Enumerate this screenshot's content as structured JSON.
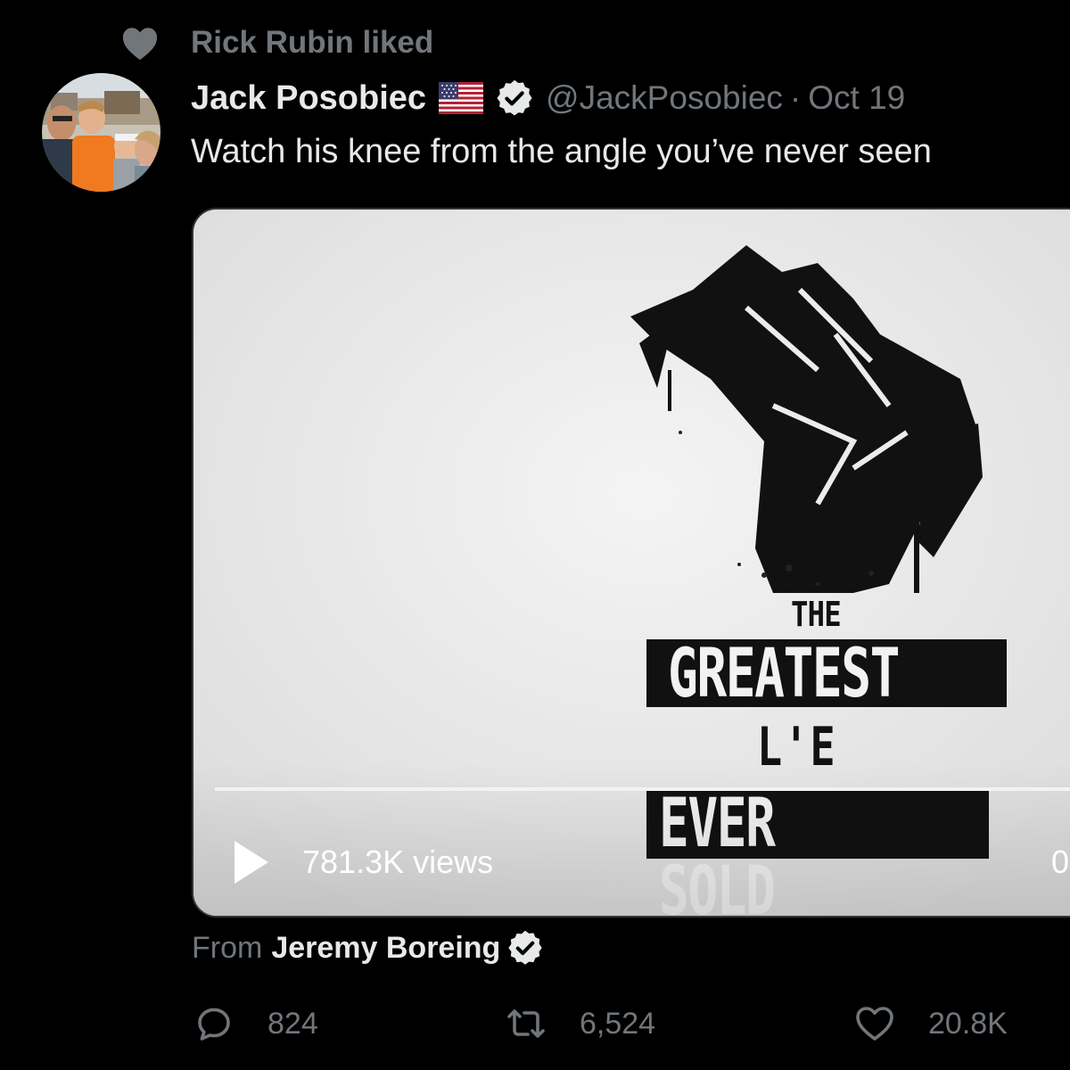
{
  "social_context": {
    "icon": "heart-icon",
    "text": "Rick Rubin liked"
  },
  "tweet": {
    "author_name": "Jack Posobiec",
    "flag_icon": "us-flag-icon",
    "verified_icon": "verified-badge-icon",
    "handle": "@JackPosobiec",
    "separator": "·",
    "date": "Oct 19",
    "text": "Watch his knee from the angle you’ve never seen"
  },
  "media": {
    "title_line_1": "THE",
    "title_line_2": "GREATEST",
    "title_line_3": "L'E",
    "title_line_4": "EVER SOLD",
    "views": "781.3K views",
    "duration_peek": "0",
    "play_icon": "play-icon"
  },
  "attribution": {
    "label": "From",
    "name": "Jeremy Boreing"
  },
  "actions": {
    "reply_count": "824",
    "retweet_count": "6,524",
    "like_count": "20.8K"
  },
  "colors": {
    "background": "#000000",
    "text_primary": "#e7e9ea",
    "text_secondary": "#71767b",
    "media_bg": "#ececec"
  }
}
